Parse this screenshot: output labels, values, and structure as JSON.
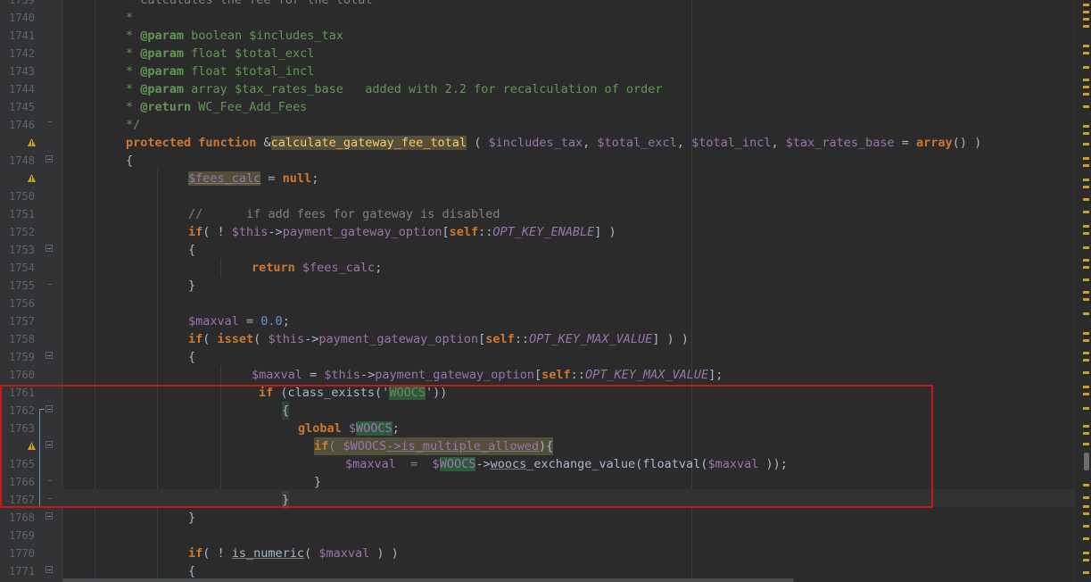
{
  "editor": {
    "lines": [
      {
        "n": "1740"
      },
      {
        "n": "1741"
      },
      {
        "n": "1742"
      },
      {
        "n": "1743"
      },
      {
        "n": "1744"
      },
      {
        "n": "1745"
      },
      {
        "n": "1746"
      },
      {
        "n": ""
      },
      {
        "n": "1748"
      },
      {
        "n": ""
      },
      {
        "n": "1750"
      },
      {
        "n": "1751"
      },
      {
        "n": "1752"
      },
      {
        "n": "1753"
      },
      {
        "n": "1754"
      },
      {
        "n": "1755"
      },
      {
        "n": "1756"
      },
      {
        "n": "1757"
      },
      {
        "n": "1758"
      },
      {
        "n": "1759"
      },
      {
        "n": "1760"
      },
      {
        "n": "1761"
      },
      {
        "n": "1762"
      },
      {
        "n": "1763"
      },
      {
        "n": ""
      },
      {
        "n": "1765"
      },
      {
        "n": "1766"
      },
      {
        "n": "1767"
      },
      {
        "n": "1768"
      },
      {
        "n": "1769"
      },
      {
        "n": "1770"
      },
      {
        "n": "1771"
      }
    ],
    "top_partial": "* Calculates the fee for the total",
    "code": {
      "l1740": "*",
      "l1741a": "* ",
      "l1741b": "@param",
      "l1741c": " boolean $includes_tax",
      "l1742a": "* ",
      "l1742b": "@param",
      "l1742c": " float $total_excl",
      "l1743a": "* ",
      "l1743b": "@param",
      "l1743c": " float $total_incl",
      "l1744a": "* ",
      "l1744b": "@param",
      "l1744c": " array $tax_rates_base   added with 2.2 for recalculation of order",
      "l1745a": "* ",
      "l1745b": "@return",
      "l1745c": " WC_Fee_Add_Fees",
      "l1746": "*/",
      "l1747_kw1": "protected",
      "l1747_kw2": "function",
      "l1747_amp": "&",
      "l1747_fn": "calculate_gateway_fee_total",
      "l1747_p1": " ( ",
      "l1747_v1": "$includes_tax",
      "l1747_c1": ", ",
      "l1747_v2": "$total_excl",
      "l1747_c2": ", ",
      "l1747_v3": "$total_incl",
      "l1747_c3": ", ",
      "l1747_v4": "$tax_rates_base",
      "l1747_eq": " = ",
      "l1747_arr": "array",
      "l1747_end": "() )",
      "l1748": "{",
      "l1749_v": "$fees_calc",
      "l1749_eq": " = ",
      "l1749_null": "null",
      "l1749_end": ";",
      "l1751": "//      if add fees for gateway is disabled",
      "l1752_if": "if",
      "l1752_a": "( ! ",
      "l1752_this": "$this",
      "l1752_arrow": "->",
      "l1752_m": "payment_gateway_option",
      "l1752_b": "[",
      "l1752_self": "self",
      "l1752_dc": "::",
      "l1752_const": "OPT_KEY_ENABLE",
      "l1752_end": "] )",
      "l1753": "{",
      "l1754_ret": "return",
      "l1754_v": " $fees_calc",
      "l1754_end": ";",
      "l1755": "}",
      "l1757_v": "$maxval",
      "l1757_eq": " = ",
      "l1757_num": "0.0",
      "l1757_end": ";",
      "l1758_if": "if",
      "l1758_a": "( ",
      "l1758_isset": "isset",
      "l1758_b": "( ",
      "l1758_this": "$this",
      "l1758_arrow": "->",
      "l1758_m": "payment_gateway_option",
      "l1758_c": "[",
      "l1758_self": "self",
      "l1758_dc": "::",
      "l1758_const": "OPT_KEY_MAX_VALUE",
      "l1758_end": "] ) )",
      "l1759": "{",
      "l1760_v": "$maxval",
      "l1760_eq": " = ",
      "l1760_this": "$this",
      "l1760_arrow": "->",
      "l1760_m": "payment_gateway_option",
      "l1760_b": "[",
      "l1760_self": "self",
      "l1760_dc": "::",
      "l1760_const": "OPT_KEY_MAX_VALUE",
      "l1760_end": "];",
      "l1761_if": "if",
      "l1761_a": " (class_exists('",
      "l1761_str": "WOOCS",
      "l1761_end": "'))",
      "l1762": "{",
      "l1763_kw": "global",
      "l1763_sp": " $",
      "l1763_v": "WOOCS",
      "l1763_end": ";",
      "l1764_if": "if",
      "l1764_a": "( $",
      "l1764_v": "WOOCS",
      "l1764_m": "->is_multiple_allowed",
      "l1764_end": "){",
      "l1765_v": "$maxval",
      "l1765_eq": "  =  $",
      "l1765_w": "WOOCS",
      "l1765_arrow": "->",
      "l1765_m": "woocs",
      "l1765_rest": "_exchange_value(floatval(",
      "l1765_v2": "$maxval",
      "l1765_end": " ));",
      "l1766": "}",
      "l1767": "}",
      "l1768": "}",
      "l1770_if": "if",
      "l1770_a": "( ! ",
      "l1770_fn": "is_numeric",
      "l1770_b": "( ",
      "l1770_v": "$maxval",
      "l1770_end": " ) )",
      "l1771": "{"
    }
  },
  "colors": {
    "background": "#2b2b2b",
    "gutter": "#313335",
    "keyword": "#cc7832",
    "variable": "#9876aa",
    "comment": "#808080",
    "doc_tag": "#629755",
    "function_name": "#ffc66d",
    "number": "#6897bb",
    "annotation_box": "#c8161d",
    "warning_marker": "#c9a227"
  }
}
